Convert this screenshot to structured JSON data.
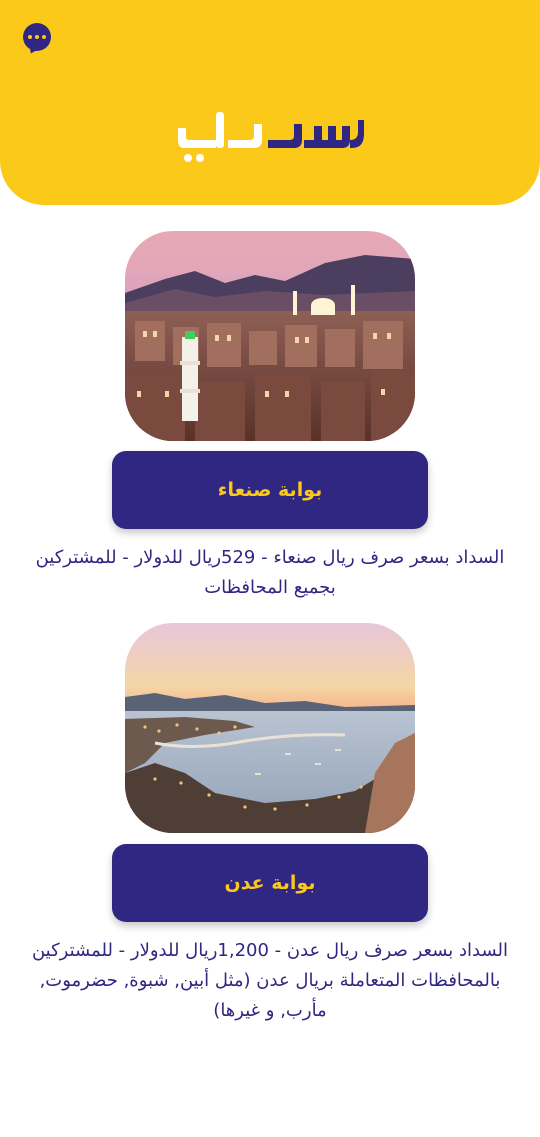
{
  "header": {
    "logo_text": "سددلي",
    "chat_icon": "chat-bubble-dots-icon"
  },
  "colors": {
    "brand_yellow": "#FBC91A",
    "brand_indigo": "#2F2782",
    "background": "#FFFFFF"
  },
  "gates": [
    {
      "button_label": "بوابة صنعاء",
      "description": "السداد بسعر صرف ريال صنعاء -  529ريال للدولار - للمشتركين بجميع المحافظات",
      "image": "sanaa-cityscape-image"
    },
    {
      "button_label": "بوابة عدن",
      "description": "السداد بسعر صرف ريال عدن -   1,200ريال للدولار - للمشتركين بالمحافظات المتعاملة بريال عدن (مثل أبين, شبوة, حضرموت, مأرب, و غيرها)",
      "image": "aden-coast-image"
    }
  ]
}
